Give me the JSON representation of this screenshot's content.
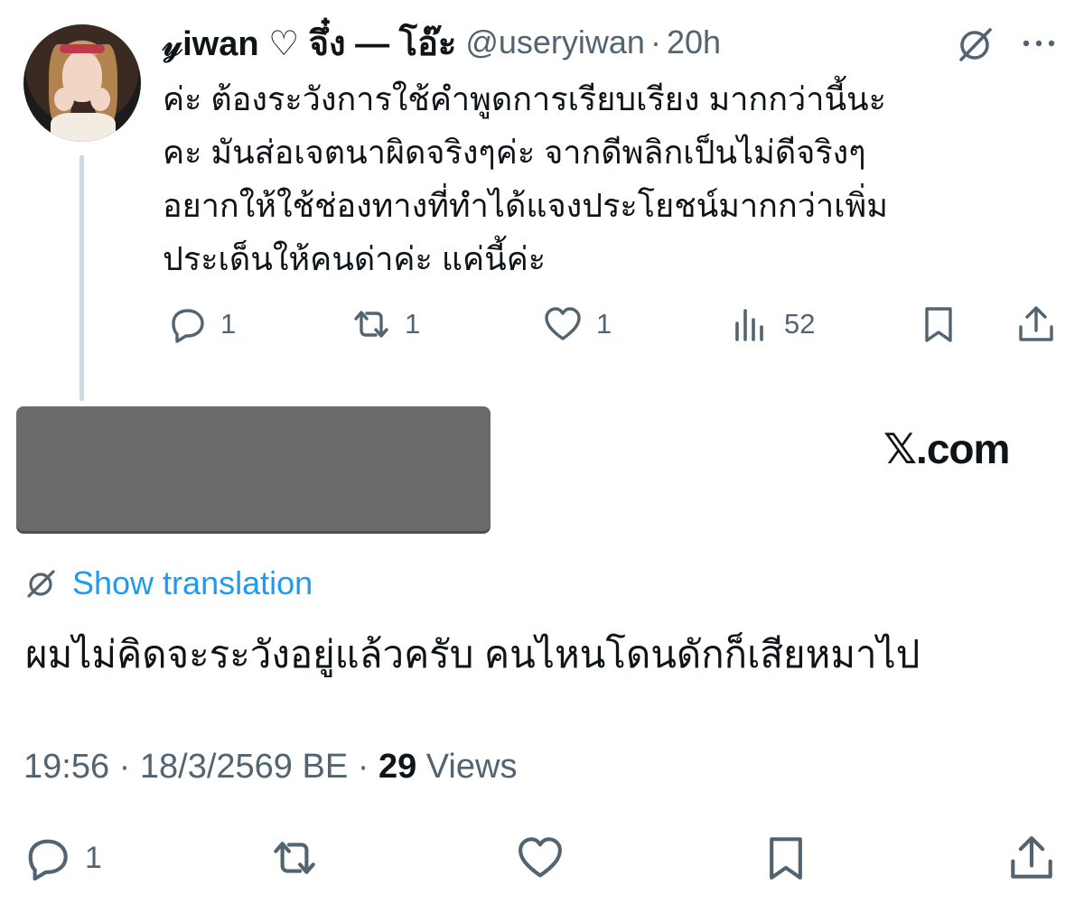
{
  "parent_tweet": {
    "display_name": "𝓎iwan ♡ จึ๋ง — โอ๊ะ",
    "handle": "@useryiwan",
    "separator": "·",
    "time": "20h",
    "text_lines": [
      "ค่ะ ต้องระวังการใช้คำพูดการเรียบเรียง มากกว่านี้นะ",
      "คะ มันส่อเจตนาผิดจริงๆค่ะ จากดีพลิกเป็นไม่ดีจริงๆ",
      "อยากให้ใช้ช่องทางที่ทำได้แจงประโยชน์มากกว่าเพิ่ม",
      "ประเด็นให้คนด่าค่ะ แค่นี้ค่ะ"
    ],
    "stats": {
      "replies": "1",
      "reposts": "1",
      "likes": "1",
      "views": "52"
    },
    "icons": {
      "translate": "globe-slash-icon",
      "more": "more-icon",
      "reply": "reply-icon",
      "repost": "repost-icon",
      "like": "heart-icon",
      "views": "analytics-icon",
      "bookmark": "bookmark-icon",
      "share": "share-icon"
    }
  },
  "watermark": "𝕏.com",
  "main_tweet": {
    "show_translation": "Show translation",
    "text": "ผมไม่คิดจะระวังอยู่แล้วครับ คนไหนโดนดักก็เสียหมาไป",
    "timestamp": "19:56 · 18/3/2569 BE · ",
    "views_count": "29",
    "views_label": " Views",
    "stats": {
      "replies": "1"
    }
  },
  "colors": {
    "text": "#0f1419",
    "secondary": "#536471",
    "link": "#1d9bf0",
    "thread_line": "#cfd9de"
  }
}
